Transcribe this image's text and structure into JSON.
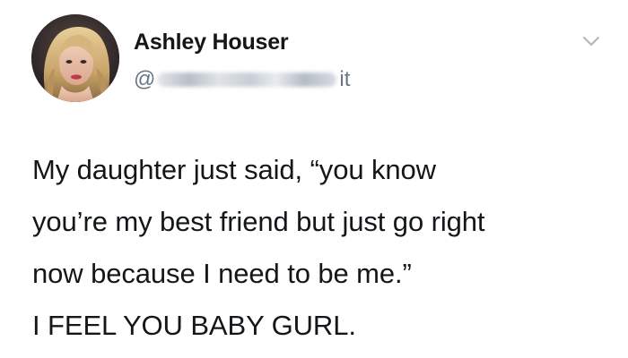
{
  "tweet": {
    "author": {
      "display_name": "Ashley Houser",
      "handle_prefix": "@",
      "handle_suffix": "it",
      "avatar_icon": "profile-photo"
    },
    "menu_icon": "chevron-down-icon",
    "text": "My daughter just said, “you know\nyou’re my best friend but just go right\nnow because I need to be me.”\nI FEEL YOU BABY GURL."
  },
  "colors": {
    "text_primary": "#14171a",
    "text_secondary": "#657786",
    "caret": "#aab8c2",
    "background": "#ffffff"
  }
}
